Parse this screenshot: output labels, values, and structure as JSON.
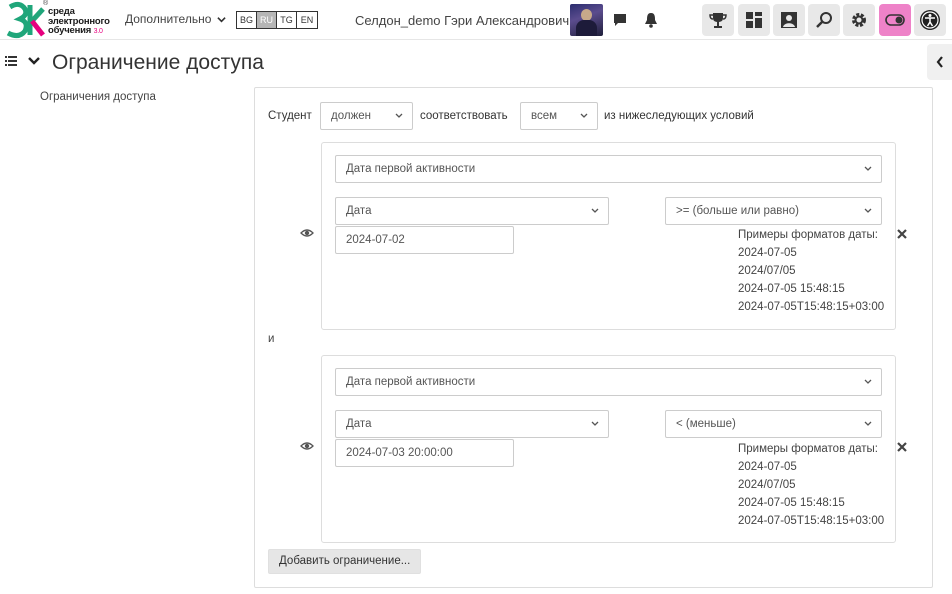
{
  "header": {
    "logo_text_1": "среда",
    "logo_text_2": "электронного",
    "logo_text_3": "обучения",
    "logo_brand": "3.0",
    "more_menu": "Дополнительно",
    "languages": [
      {
        "code": "BG",
        "active": false
      },
      {
        "code": "RU",
        "active": true
      },
      {
        "code": "TG",
        "active": false
      },
      {
        "code": "EN",
        "active": false
      }
    ],
    "user_name": "Селдон_demo Гэри Александрович",
    "accent_pink": "#ee82c8"
  },
  "page": {
    "title": "Ограничение доступа",
    "side_label": "Ограничения доступа"
  },
  "restriction": {
    "intro_student": "Студент",
    "must_select": "должен",
    "match_text": "соответствовать",
    "all_select": "всем",
    "conditions_text": "из нижеследующих условий",
    "and_label": "и",
    "add_button": "Добавить ограничение...",
    "conditions": [
      {
        "type_select": "Дата первой активности",
        "field_select": "Дата",
        "operator_select": ">= (больше или равно)",
        "value": "2024-07-02",
        "formats_title": "Примеры форматов даты:",
        "formats": [
          "2024-07-05",
          "2024/07/05",
          "2024-07-05 15:48:15",
          "2024-07-05T15:48:15+03:00"
        ]
      },
      {
        "type_select": "Дата первой активности",
        "field_select": "Дата",
        "operator_select": "< (меньше)",
        "value": "2024-07-03 20:00:00",
        "formats_title": "Примеры форматов даты:",
        "formats": [
          "2024-07-05",
          "2024/07/05",
          "2024-07-05 15:48:15",
          "2024-07-05T15:48:15+03:00"
        ]
      }
    ]
  }
}
